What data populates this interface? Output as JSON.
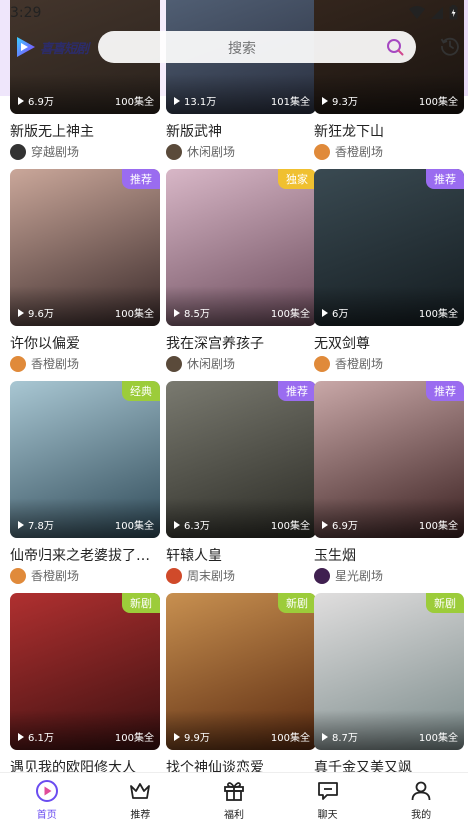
{
  "status": {
    "time": "3:29"
  },
  "app": {
    "logo_text": "喜喜短剧"
  },
  "search": {
    "placeholder": "搜索"
  },
  "cards": [
    {
      "title": "新版无上神主",
      "views": "6.9万",
      "episodes": "100集全",
      "source": "穿越剧场",
      "tag": "",
      "poster_colors": [
        "#4a3a30",
        "#2a221c"
      ]
    },
    {
      "title": "新版武神",
      "views": "13.1万",
      "episodes": "101集全",
      "source": "休闲剧场",
      "tag": "",
      "poster_colors": [
        "#5a6a80",
        "#2a3040"
      ]
    },
    {
      "title": "新狂龙下山",
      "views": "9.3万",
      "episodes": "100集全",
      "source": "香橙剧场",
      "tag": "",
      "poster_colors": [
        "#3a2a20",
        "#1a1410"
      ]
    },
    {
      "title": "许你以偏爱",
      "views": "9.6万",
      "episodes": "100集全",
      "source": "香橙剧场",
      "tag": "推荐",
      "tag_color": "purple",
      "poster_colors": [
        "#caa79a",
        "#3a2a2a"
      ]
    },
    {
      "title": "我在深宫养孩子",
      "views": "8.5万",
      "episodes": "100集全",
      "source": "休闲剧场",
      "tag": "独家",
      "tag_color": "yellow",
      "poster_colors": [
        "#d8b7c7",
        "#6a4a5a"
      ]
    },
    {
      "title": "无双剑尊",
      "views": "6万",
      "episodes": "100集全",
      "source": "香橙剧场",
      "tag": "推荐",
      "tag_color": "purple",
      "poster_colors": [
        "#3a4a52",
        "#141c20"
      ]
    },
    {
      "title": "仙帝归来之老婆拔了…",
      "views": "7.8万",
      "episodes": "100集全",
      "source": "香橙剧场",
      "tag": "经典",
      "tag_color": "green",
      "poster_colors": [
        "#a9c7d3",
        "#2f4a58"
      ]
    },
    {
      "title": "轩辕人皇",
      "views": "6.3万",
      "episodes": "100集全",
      "source": "周末剧场",
      "tag": "推荐",
      "tag_color": "purple",
      "poster_colors": [
        "#7a7a70",
        "#2a2a24"
      ]
    },
    {
      "title": "玉生烟",
      "views": "6.9万",
      "episodes": "100集全",
      "source": "星光剧场",
      "tag": "推荐",
      "tag_color": "purple",
      "poster_colors": [
        "#c9a8a8",
        "#3a2020"
      ]
    },
    {
      "title": "遇见我的欧阳修大人",
      "views": "6.1万",
      "episodes": "100集全",
      "source": "",
      "tag": "新剧",
      "tag_color": "green",
      "poster_colors": [
        "#b03030",
        "#3a1010"
      ]
    },
    {
      "title": "找个神仙谈恋爱",
      "views": "9.9万",
      "episodes": "100集全",
      "source": "",
      "tag": "新剧",
      "tag_color": "green",
      "poster_colors": [
        "#c89050",
        "#5a2a10"
      ]
    },
    {
      "title": "真千金又美又飒",
      "views": "8.7万",
      "episodes": "100集全",
      "source": "",
      "tag": "新剧",
      "tag_color": "green",
      "poster_colors": [
        "#e0dede",
        "#7a8a8a"
      ]
    }
  ],
  "nav": [
    {
      "label": "首页",
      "icon": "home-play-icon",
      "active": true
    },
    {
      "label": "推荐",
      "icon": "crown-icon",
      "active": false
    },
    {
      "label": "福利",
      "icon": "gift-icon",
      "active": false
    },
    {
      "label": "聊天",
      "icon": "chat-icon",
      "active": false
    },
    {
      "label": "我的",
      "icon": "user-icon",
      "active": false
    }
  ],
  "colors": {
    "accent": "#6a4cf0",
    "tag_purple": "#9a6cf0",
    "tag_green": "#9ccc3a",
    "tag_yellow": "#f0c030"
  }
}
